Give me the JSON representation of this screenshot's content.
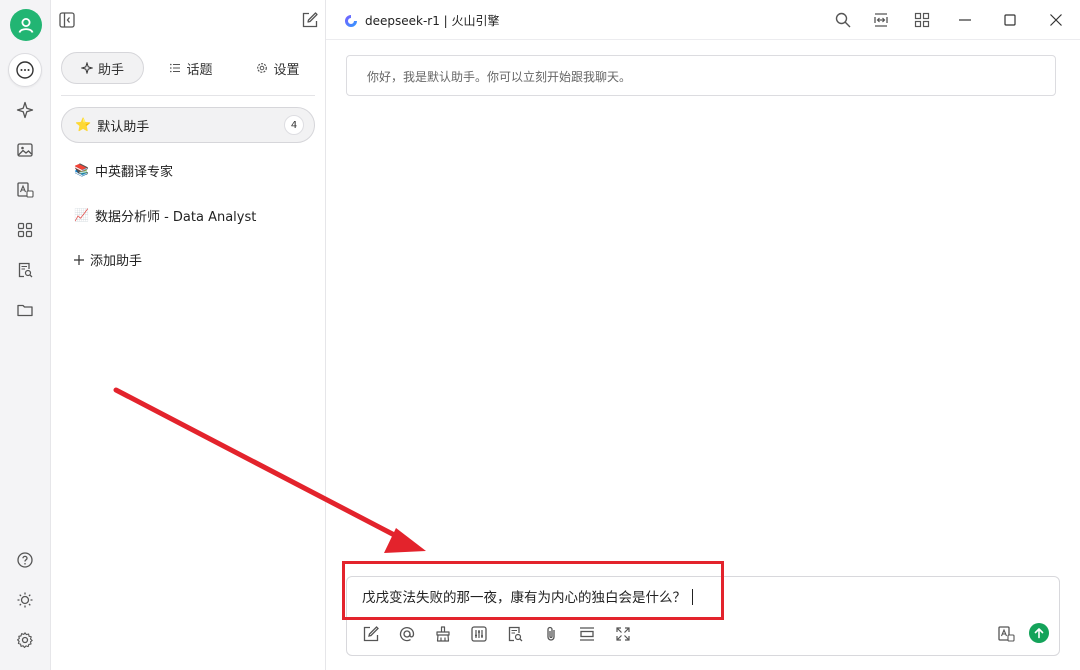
{
  "rail": {
    "icons": [
      "user-avatar",
      "chat-icon",
      "sparkle-icon",
      "image-icon",
      "translate-icon",
      "apps-icon",
      "document-search-icon",
      "folder-icon",
      "help-icon",
      "brightness-icon",
      "settings-icon"
    ],
    "avatar_color": "#22b573"
  },
  "sidebar": {
    "tabs": [
      {
        "icon": "sparkle-icon",
        "label": "助手"
      },
      {
        "icon": "list-icon",
        "label": "话题"
      },
      {
        "icon": "gear-icon",
        "label": "设置"
      }
    ],
    "assistants": [
      {
        "emoji": "⭐",
        "name": "默认助手",
        "count": "4"
      },
      {
        "emoji": "📚",
        "name": "中英翻译专家"
      },
      {
        "emoji": "📈",
        "name": "数据分析师 - Data Analyst"
      }
    ],
    "add_label": "添加助手"
  },
  "header": {
    "model_name": "deepseek-r1 | 火山引擎",
    "model_name_visible": "deepseek-r1 | 火山引擎"
  },
  "chat": {
    "greeting": "你好，我是默认助手。你可以立刻开始跟我聊天。"
  },
  "composer": {
    "text": "戊戌变法失败的那一夜，康有为内心的独白会是什么？",
    "tools": [
      "edit-icon",
      "at-icon",
      "broom-icon",
      "sliders-icon",
      "document-search-icon",
      "paperclip-icon",
      "text-icon",
      "expand-icon"
    ],
    "send_color": "#14a35a"
  },
  "annotation": {
    "color": "#e3232c"
  }
}
